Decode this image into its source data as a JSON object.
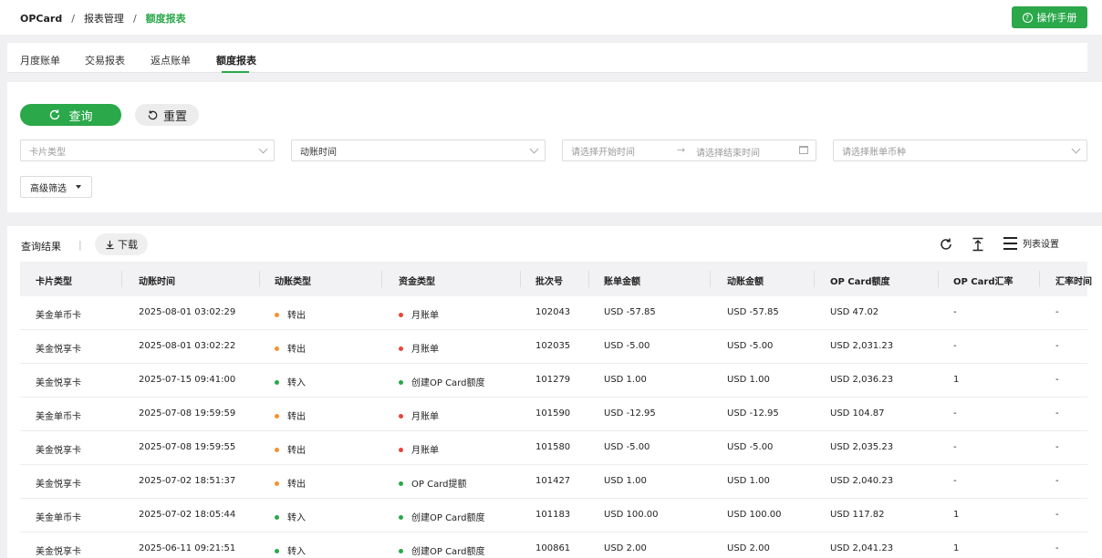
{
  "breadcrumb": {
    "home": "OPCard",
    "section": "报表管理",
    "current": "额度报表",
    "separator": "/"
  },
  "header": {
    "manual_button": "操作手册"
  },
  "tabs": [
    {
      "label": "月度账单",
      "active": false
    },
    {
      "label": "交易报表",
      "active": false
    },
    {
      "label": "返点账单",
      "active": false
    },
    {
      "label": "额度报表",
      "active": true
    }
  ],
  "filters": {
    "query_button": "查询",
    "reset_button": "重置",
    "card_type_placeholder": "卡片类型",
    "movement_time_value": "动账时间",
    "date_start_placeholder": "请选择开始时间",
    "date_arrow": "→",
    "date_end_placeholder": "请选择结束时间",
    "currency_placeholder": "请选择账单币种",
    "advanced_button": "高级筛选"
  },
  "results": {
    "title": "查询结果",
    "separator": "|",
    "download_button": "下载",
    "column_settings": "列表设置",
    "columns": [
      "卡片类型",
      "动账时间",
      "动账类型",
      "资金类型",
      "批次号",
      "账单金额",
      "动账金额",
      "OP Card额度",
      "OP Card汇率",
      "汇率时间"
    ],
    "rows": [
      {
        "card_type": "美金单币卡",
        "time": "2025-08-01 03:02:29",
        "movement_type": "转出",
        "movement_color": "#f5922f",
        "fund_type": "月账单",
        "fund_color": "#e8443a",
        "batch": "102043",
        "bill_amount": "USD -57.85",
        "movement_amount": "USD -57.85",
        "quota": "USD 47.02",
        "rate": "-",
        "rate_time": "-"
      },
      {
        "card_type": "美金悦享卡",
        "time": "2025-08-01 03:02:22",
        "movement_type": "转出",
        "movement_color": "#f5922f",
        "fund_type": "月账单",
        "fund_color": "#e8443a",
        "batch": "102035",
        "bill_amount": "USD -5.00",
        "movement_amount": "USD -5.00",
        "quota": "USD 2,031.23",
        "rate": "-",
        "rate_time": "-"
      },
      {
        "card_type": "美金悦享卡",
        "time": "2025-07-15 09:41:00",
        "movement_type": "转入",
        "movement_color": "#2aa84a",
        "fund_type": "创建OP Card额度",
        "fund_color": "#2aa84a",
        "batch": "101279",
        "bill_amount": "USD 1.00",
        "movement_amount": "USD 1.00",
        "quota": "USD 2,036.23",
        "rate": "1",
        "rate_time": "-"
      },
      {
        "card_type": "美金单币卡",
        "time": "2025-07-08 19:59:59",
        "movement_type": "转出",
        "movement_color": "#f5922f",
        "fund_type": "月账单",
        "fund_color": "#e8443a",
        "batch": "101590",
        "bill_amount": "USD -12.95",
        "movement_amount": "USD -12.95",
        "quota": "USD 104.87",
        "rate": "-",
        "rate_time": "-"
      },
      {
        "card_type": "美金悦享卡",
        "time": "2025-07-08 19:59:55",
        "movement_type": "转出",
        "movement_color": "#f5922f",
        "fund_type": "月账单",
        "fund_color": "#e8443a",
        "batch": "101580",
        "bill_amount": "USD -5.00",
        "movement_amount": "USD -5.00",
        "quota": "USD 2,035.23",
        "rate": "-",
        "rate_time": "-"
      },
      {
        "card_type": "美金悦享卡",
        "time": "2025-07-02 18:51:37",
        "movement_type": "转出",
        "movement_color": "#f5922f",
        "fund_type": "OP Card提额",
        "fund_color": "#2aa84a",
        "batch": "101427",
        "bill_amount": "USD 1.00",
        "movement_amount": "USD 1.00",
        "quota": "USD 2,040.23",
        "rate": "-",
        "rate_time": "-"
      },
      {
        "card_type": "美金单币卡",
        "time": "2025-07-02 18:05:44",
        "movement_type": "转入",
        "movement_color": "#2aa84a",
        "fund_type": "创建OP Card额度",
        "fund_color": "#2aa84a",
        "batch": "101183",
        "bill_amount": "USD 100.00",
        "movement_amount": "USD 100.00",
        "quota": "USD 117.82",
        "rate": "1",
        "rate_time": "-"
      },
      {
        "card_type": "美金悦享卡",
        "time": "2025-06-11 09:21:51",
        "movement_type": "转入",
        "movement_color": "#2aa84a",
        "fund_type": "创建OP Card额度",
        "fund_color": "#2aa84a",
        "batch": "100861",
        "bill_amount": "USD 2.00",
        "movement_amount": "USD 2.00",
        "quota": "USD 2,041.23",
        "rate": "1",
        "rate_time": "-"
      }
    ]
  },
  "icons": {
    "help": "question-circle-icon",
    "refresh": "refresh-icon",
    "reset": "undo-icon",
    "download": "download-icon",
    "export": "align-top-icon",
    "columns": "list-settings-icon",
    "calendar": "calendar-icon"
  },
  "colors": {
    "accent": "#2aa84a",
    "outgoing": "#f5922f",
    "monthly_bill": "#e8443a"
  }
}
